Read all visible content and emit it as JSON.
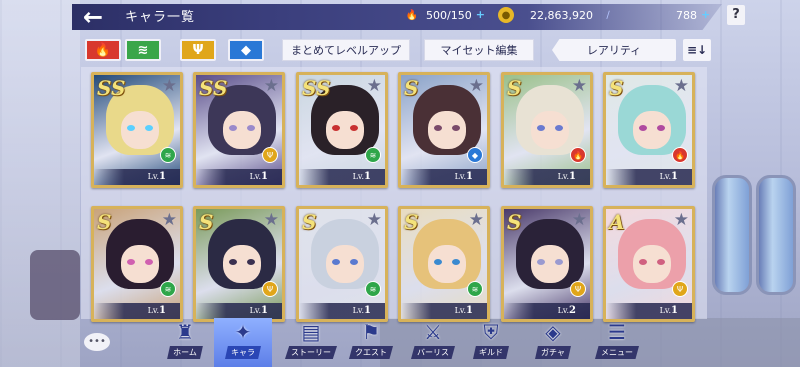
{
  "header": {
    "title": "キャラ一覧",
    "back_icon": "arrow-left-icon",
    "stamina": "500/150",
    "coins": "22,863,920",
    "crystals": "788",
    "help": "?"
  },
  "filters": {
    "elements": [
      {
        "icon": "fire-icon",
        "glyph": "🔥",
        "color": "#d8382e"
      },
      {
        "icon": "wind-icon",
        "glyph": "≋",
        "color": "#3aa64a"
      },
      {
        "icon": "thunder-icon",
        "glyph": "Ψ",
        "color": "#e0a61a"
      },
      {
        "icon": "water-icon",
        "glyph": "◆",
        "color": "#2a78d6"
      }
    ],
    "bulk_levelup": "まとめてレベルアップ",
    "myset_edit": "マイセット編集",
    "rarity": "レアリティ",
    "sort_icon": "sort-icon"
  },
  "cards": [
    {
      "rank": "SS",
      "lv": "1",
      "elem_color": "#2fa64a",
      "elem": "wind",
      "hair": "#e9d98a",
      "bg": "#224a7a",
      "eye": "#5bd0ff"
    },
    {
      "rank": "SS",
      "lv": "1",
      "elem_color": "#e0a61a",
      "elem": "thunder",
      "hair": "#3d3758",
      "bg": "#5a4d8a",
      "eye": "#9a8acb"
    },
    {
      "rank": "SS",
      "lv": "1",
      "elem_color": "#2fa64a",
      "elem": "wind",
      "hair": "#2a2128",
      "bg": "#c9d6e0",
      "eye": "#c83030"
    },
    {
      "rank": "S",
      "lv": "1",
      "elem_color": "#2a78d6",
      "elem": "water",
      "hair": "#4a3036",
      "bg": "#8aa2c8",
      "eye": "#7a4a6a"
    },
    {
      "rank": "S",
      "lv": "1",
      "elem_color": "#d8382e",
      "elem": "fire",
      "hair": "#e8e2d4",
      "bg": "#9ac08a",
      "eye": "#6a7ad0"
    },
    {
      "rank": "S",
      "lv": "1",
      "elem_color": "#d8382e",
      "elem": "fire",
      "hair": "#9ad8d6",
      "bg": "#dfe8e6",
      "eye": "#b04aa0"
    },
    {
      "rank": "S",
      "lv": "1",
      "elem_color": "#2fa64a",
      "elem": "wind",
      "hair": "#2a1d30",
      "bg": "#c9a37a",
      "eye": "#d060b0"
    },
    {
      "rank": "S",
      "lv": "1",
      "elem_color": "#e0a61a",
      "elem": "thunder",
      "hair": "#2b2a44",
      "bg": "#7a9a5a",
      "eye": "#3a3050"
    },
    {
      "rank": "S",
      "lv": "1",
      "elem_color": "#2fa64a",
      "elem": "wind",
      "hair": "#c9d1df",
      "bg": "#dfe2ea",
      "eye": "#5a7ad0"
    },
    {
      "rank": "S",
      "lv": "1",
      "elem_color": "#2fa64a",
      "elem": "wind",
      "hair": "#e6c27a",
      "bg": "#e8dcc0",
      "eye": "#3a8ad0"
    },
    {
      "rank": "S",
      "lv": "2",
      "elem_color": "#e0a61a",
      "elem": "thunder",
      "hair": "#2a2238",
      "bg": "#4a3a6a",
      "eye": "#9a9ad0"
    },
    {
      "rank": "A",
      "lv": "1",
      "elem_color": "#e0a61a",
      "elem": "thunder",
      "hair": "#eca0aa",
      "bg": "#f3d8dc",
      "eye": "#d06080"
    }
  ],
  "lv_prefix": "Lv.",
  "nav": {
    "chat_icon": "chat-bubble-icon",
    "items": [
      {
        "label": "ホーム",
        "icon": "tower-icon",
        "glyph": "♜"
      },
      {
        "label": "キャラ",
        "icon": "character-icon",
        "glyph": "✦"
      },
      {
        "label": "ストーリー",
        "icon": "book-icon",
        "glyph": "▤"
      },
      {
        "label": "クエスト",
        "icon": "quest-icon",
        "glyph": "⚑"
      },
      {
        "label": "バーリス",
        "icon": "swords-icon",
        "glyph": "⚔"
      },
      {
        "label": "ギルド",
        "icon": "shield-icon",
        "glyph": "⛨"
      },
      {
        "label": "ガチャ",
        "icon": "gacha-icon",
        "glyph": "◈"
      },
      {
        "label": "メニュー",
        "icon": "menu-icon",
        "glyph": "☰"
      }
    ],
    "active_index": 1
  }
}
